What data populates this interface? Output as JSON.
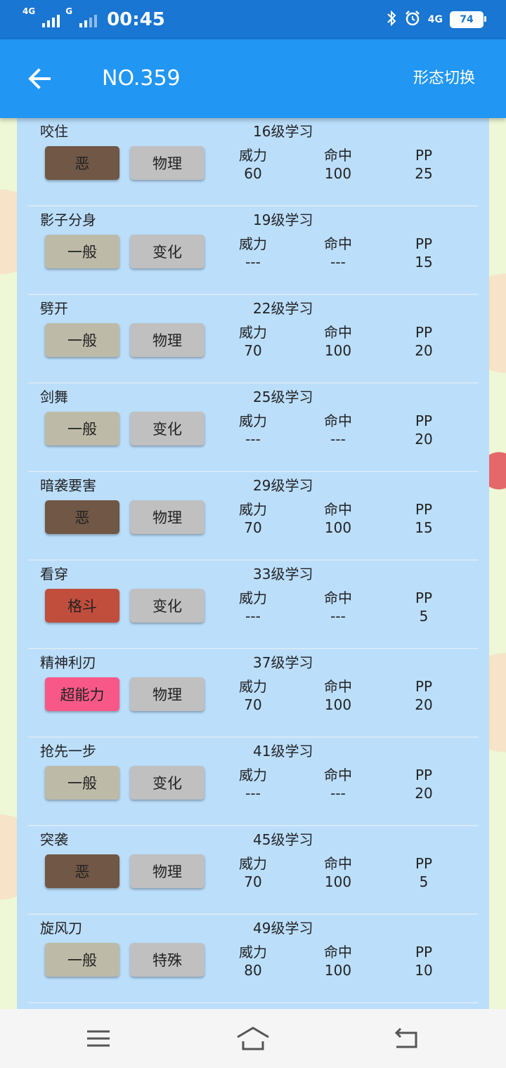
{
  "status_bar": {
    "network_1": "4G",
    "network_2": "G",
    "time": "00:45",
    "network_3": "4G",
    "battery": "74"
  },
  "app_bar": {
    "title": "NO.359",
    "mode_switch_label": "形态切换"
  },
  "stat_labels": {
    "power": "威力",
    "accuracy": "命中",
    "pp": "PP"
  },
  "type_colors": {
    "恶": "#705746",
    "一般": "#bdbba8",
    "格斗": "#c14d3d",
    "超能力": "#f85888"
  },
  "moves": [
    {
      "name": "咬住",
      "level": "16级学习",
      "type": "恶",
      "category": "物理",
      "power": "60",
      "accuracy": "100",
      "pp": "25"
    },
    {
      "name": "影子分身",
      "level": "19级学习",
      "type": "一般",
      "category": "变化",
      "power": "---",
      "accuracy": "---",
      "pp": "15"
    },
    {
      "name": "劈开",
      "level": "22级学习",
      "type": "一般",
      "category": "物理",
      "power": "70",
      "accuracy": "100",
      "pp": "20"
    },
    {
      "name": "剑舞",
      "level": "25级学习",
      "type": "一般",
      "category": "变化",
      "power": "---",
      "accuracy": "---",
      "pp": "20"
    },
    {
      "name": "暗袭要害",
      "level": "29级学习",
      "type": "恶",
      "category": "物理",
      "power": "70",
      "accuracy": "100",
      "pp": "15"
    },
    {
      "name": "看穿",
      "level": "33级学习",
      "type": "格斗",
      "category": "变化",
      "power": "---",
      "accuracy": "---",
      "pp": "5"
    },
    {
      "name": "精神利刃",
      "level": "37级学习",
      "type": "超能力",
      "category": "物理",
      "power": "70",
      "accuracy": "100",
      "pp": "20"
    },
    {
      "name": "抢先一步",
      "level": "41级学习",
      "type": "一般",
      "category": "变化",
      "power": "---",
      "accuracy": "---",
      "pp": "20"
    },
    {
      "name": "突袭",
      "level": "45级学习",
      "type": "恶",
      "category": "物理",
      "power": "70",
      "accuracy": "100",
      "pp": "5"
    },
    {
      "name": "旋风刀",
      "level": "49级学习",
      "type": "一般",
      "category": "特殊",
      "power": "80",
      "accuracy": "100",
      "pp": "10"
    }
  ]
}
